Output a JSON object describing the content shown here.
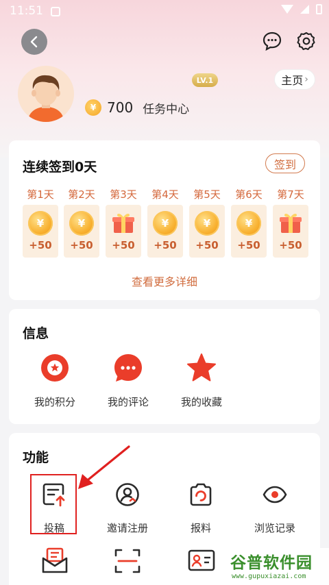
{
  "status_bar": {
    "time": "11:51"
  },
  "header": {
    "level_badge": "LV.1",
    "home_label": "主页",
    "home_arrow": "›"
  },
  "user": {
    "coins": "700",
    "task_center_label": "任务中心",
    "coin_symbol": "¥"
  },
  "checkin": {
    "title": "连续签到0天",
    "button_label": "签到",
    "days": [
      {
        "label": "第1天",
        "points": "+50",
        "reward": "coin"
      },
      {
        "label": "第2天",
        "points": "+50",
        "reward": "coin"
      },
      {
        "label": "第3天",
        "points": "+50",
        "reward": "gift"
      },
      {
        "label": "第4天",
        "points": "+50",
        "reward": "coin"
      },
      {
        "label": "第5天",
        "points": "+50",
        "reward": "coin"
      },
      {
        "label": "第6天",
        "points": "+50",
        "reward": "coin"
      },
      {
        "label": "第7天",
        "points": "+50",
        "reward": "gift"
      }
    ],
    "more_link": "查看更多详细"
  },
  "info": {
    "title": "信息",
    "items": [
      {
        "label": "我的积分",
        "icon": "points-icon"
      },
      {
        "label": "我的评论",
        "icon": "comment-icon"
      },
      {
        "label": "我的收藏",
        "icon": "star-icon"
      }
    ]
  },
  "functions": {
    "title": "功能",
    "items": [
      {
        "label": "投稿",
        "icon": "submit-icon"
      },
      {
        "label": "邀请注册",
        "icon": "invite-icon"
      },
      {
        "label": "报料",
        "icon": "camera-icon"
      },
      {
        "label": "浏览记录",
        "icon": "eye-icon"
      }
    ]
  },
  "watermark": {
    "title": "谷普软件园",
    "url": "www.gupuxiazai.com"
  },
  "colors": {
    "accent": "#d16d3f",
    "brand_red": "#e8402a",
    "highlight": "#e0201f"
  }
}
